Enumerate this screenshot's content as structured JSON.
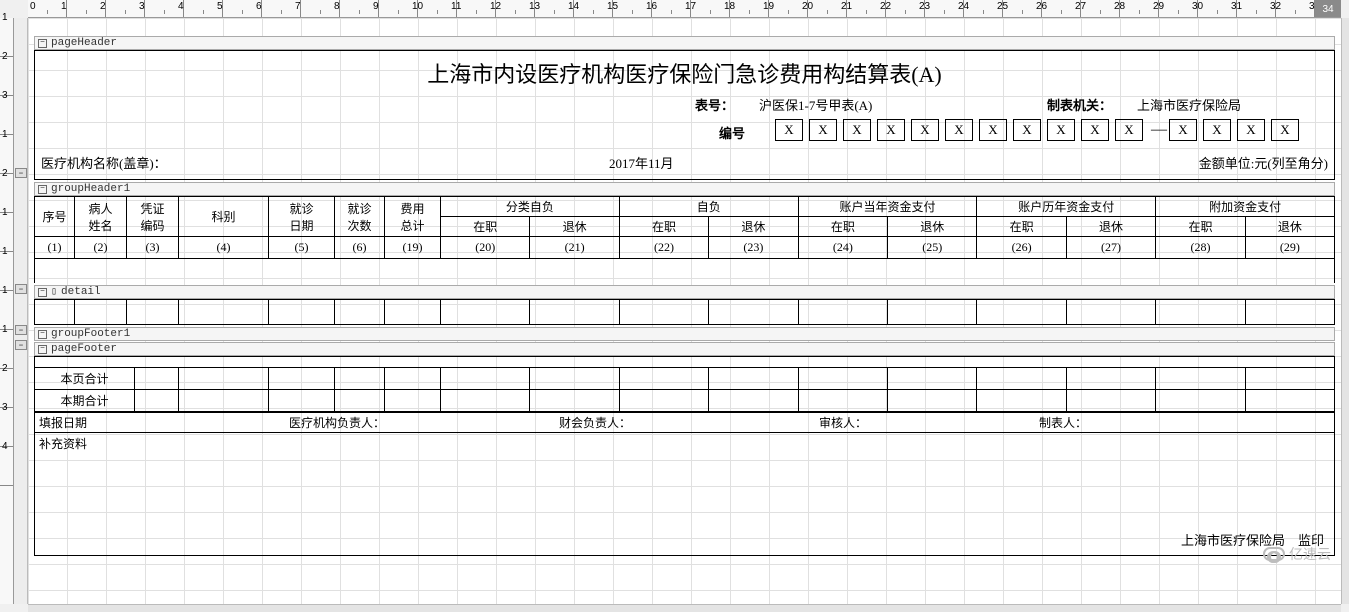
{
  "ruler": {
    "count": 34,
    "end": "34"
  },
  "vruler": [
    1,
    2,
    3,
    1,
    2,
    1,
    1,
    1,
    1,
    2,
    3,
    4
  ],
  "bands": {
    "pageHeader": "pageHeader",
    "groupHeader": "groupHeader1",
    "detail": "detail",
    "groupFooter": "groupFooter1",
    "pageFooter": "pageFooter"
  },
  "title": "上海市内设医疗机构医疗保险门急诊费用构结算表(A)",
  "meta": {
    "biaohao_lbl": "表号：",
    "biaohao_val": "沪医保1-7号甲表(A)",
    "zhibiao_lbl": "制表机关：",
    "zhibiao_val": "上海市医疗保险局",
    "bianhao_lbl": "编号",
    "bianhao_boxes": [
      "X",
      "X",
      "X",
      "X",
      "X",
      "X",
      "X",
      "X",
      "X",
      "X",
      "X",
      "—",
      "X",
      "X",
      "X",
      "X"
    ],
    "org_lbl": "医疗机构名称(盖章)：",
    "period": "2017年11月",
    "unit": "金额单位:元(列至角分)"
  },
  "header": {
    "cols1": [
      "序号",
      "病人\n姓名",
      "凭证\n编码",
      "科别",
      "就诊\n日期",
      "就诊\n次数",
      "费用\n总计"
    ],
    "groups": [
      "分类自负",
      "自负",
      "账户当年资金支付",
      "账户历年资金支付",
      "附加资金支付"
    ],
    "subs": [
      "在职",
      "退休",
      "在职",
      "退休",
      "在职",
      "退休",
      "在职",
      "退休",
      "在职",
      "退休"
    ],
    "nums": [
      "(1)",
      "(2)",
      "(3)",
      "(4)",
      "(5)",
      "(6)",
      "(19)",
      "(20)",
      "(21)",
      "(22)",
      "(23)",
      "(24)",
      "(25)",
      "(26)",
      "(27)",
      "(28)",
      "(29)"
    ]
  },
  "footer": {
    "page_total": "本页合计",
    "period_total": "本期合计",
    "fill_date": "填报日期",
    "org_resp": "医疗机构负责人：",
    "fin_resp": "财会负责人：",
    "auditor": "审核人：",
    "preparer": "制表人：",
    "supplement": "补充资料",
    "issuer": "上海市医疗保险局",
    "seal": "监印"
  },
  "watermark": "亿速云"
}
